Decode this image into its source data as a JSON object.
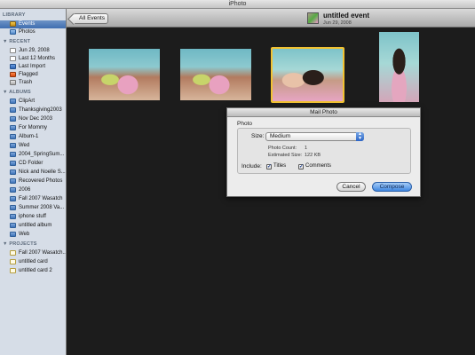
{
  "window": {
    "title": "iPhoto"
  },
  "toolbar": {
    "all_events_label": "All Events",
    "event_title": "untitled event",
    "event_date": "Jun 29, 2008"
  },
  "sidebar": {
    "library_header": "LIBRARY",
    "library": [
      {
        "label": "Events",
        "icon": "events-icon",
        "selected": true
      },
      {
        "label": "Photos",
        "icon": "photos-icon"
      }
    ],
    "recent_header": "RECENT",
    "recent": [
      {
        "label": "Jun 29, 2008",
        "icon": "calendar-icon"
      },
      {
        "label": "Last 12 Months",
        "icon": "calendar-icon"
      },
      {
        "label": "Last Import",
        "icon": "import-icon"
      },
      {
        "label": "Flagged",
        "icon": "flag-icon"
      },
      {
        "label": "Trash",
        "icon": "trash-icon"
      }
    ],
    "albums_header": "ALBUMS",
    "albums": [
      "ClipArt",
      "Thanksgiving2003",
      "Nov Dec 2003",
      "For Mommy",
      "Album-1",
      "Wed",
      "2004_SpringSum...",
      "CD Folder",
      "Nick and Noelle S...",
      "Recovered Photos",
      "2006",
      "Fall 2007 Wasatch",
      "Summer 2008 Va...",
      "iphone stuff",
      "untitled album",
      "Web"
    ],
    "projects_header": "PROJECTS",
    "projects": [
      "Fall 2007 Wasatch...",
      "untitled card",
      "untitled card 2"
    ]
  },
  "photos": [
    {
      "name": "photo-1"
    },
    {
      "name": "photo-2"
    },
    {
      "name": "photo-3",
      "selected": true
    },
    {
      "name": "photo-4"
    }
  ],
  "dialog": {
    "title": "Mail Photo",
    "group_label": "Photo",
    "size_label": "Size:",
    "size_value": "Medium",
    "photo_count_label": "Photo Count:",
    "photo_count_value": "1",
    "estimated_size_label": "Estimated Size:",
    "estimated_size_value": "122 KB",
    "include_label": "Include:",
    "titles_label": "Titles",
    "titles_checked": true,
    "comments_label": "Comments",
    "comments_checked": true,
    "cancel_label": "Cancel",
    "compose_label": "Compose"
  },
  "colors": {
    "selection_blue": "#3f6eb0",
    "sidebar_bg": "#d6dde7",
    "selected_photo_border": "#f1c232",
    "default_button": "#3f86e0"
  }
}
